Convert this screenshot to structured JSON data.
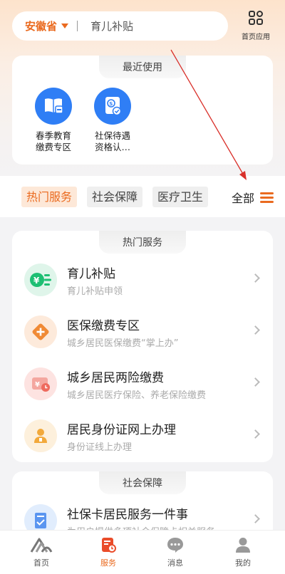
{
  "header": {
    "region": "安徽省",
    "search_text": "育儿补贴",
    "home_apps_label": "首页应用"
  },
  "recent": {
    "title": "最近使用",
    "items": [
      {
        "label_line1": "春季教育",
        "label_line2": "缴费专区",
        "icon": "book-icon"
      },
      {
        "label_line1": "社保待遇",
        "label_line2": "资格认…",
        "icon": "social-security-icon"
      }
    ]
  },
  "tabs": {
    "items": [
      {
        "label": "热门服务",
        "active": true
      },
      {
        "label": "社会保障",
        "active": false
      },
      {
        "label": "医疗卫生",
        "active": false
      }
    ],
    "all_label": "全部"
  },
  "hot_services": {
    "title": "热门服务",
    "items": [
      {
        "title": "育儿补贴",
        "subtitle": "育儿补贴申领",
        "icon": "yuan-coin-icon"
      },
      {
        "title": "医保缴费专区",
        "subtitle": "城乡居民医保缴费“掌上办”",
        "icon": "medical-plus-icon"
      },
      {
        "title": "城乡居民两险缴费",
        "subtitle": "城乡居民医疗保险、养老保险缴费",
        "icon": "wallet-yuan-icon"
      },
      {
        "title": "居民身份证网上办理",
        "subtitle": "身份证线上办理",
        "icon": "id-person-icon"
      }
    ]
  },
  "social_security": {
    "title": "社会保障",
    "items": [
      {
        "title": "社保卡居民服务一件事",
        "subtitle": "为用户提供多项社会保障卡相关服务",
        "icon": "document-check-icon"
      }
    ]
  },
  "bottom_nav": {
    "items": [
      {
        "label": "首页",
        "icon": "home-logo-icon",
        "active": false
      },
      {
        "label": "服务",
        "icon": "service-icon",
        "active": true
      },
      {
        "label": "消息",
        "icon": "message-icon",
        "active": false
      },
      {
        "label": "我的",
        "icon": "profile-icon",
        "active": false
      }
    ]
  },
  "colors": {
    "accent": "#ea6a1f",
    "blue": "#2f7ef5"
  }
}
